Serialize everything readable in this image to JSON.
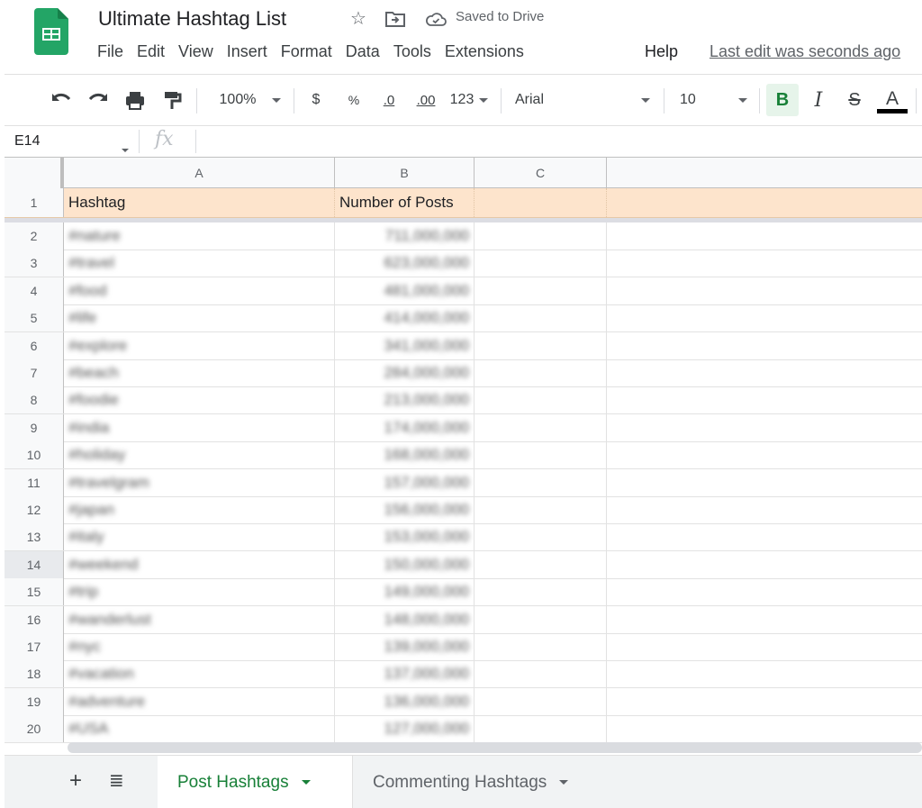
{
  "app": {
    "doc_title": "Ultimate Hashtag List",
    "saved_status": "Saved to Drive",
    "last_edit": "Last edit was seconds ago",
    "brand_color": "#188038",
    "header_fill": "#fde4cc"
  },
  "title_icons": [
    "star-icon",
    "move-to-folder-icon",
    "cloud-saved-icon"
  ],
  "menu": [
    "File",
    "Edit",
    "View",
    "Insert",
    "Format",
    "Data",
    "Tools",
    "Extensions"
  ],
  "menu_help": "Help",
  "toolbar": {
    "zoom": "100%",
    "currency": "$",
    "percent": "%",
    "decrease_decimal": ".0",
    "increase_decimal": ".00",
    "more_formats": "123",
    "font": "Arial",
    "font_size": "10",
    "bold": "B",
    "italic": "I",
    "strikethrough": "S",
    "text_color": "A"
  },
  "formula_bar": {
    "name_box": "E14",
    "fx": "fx",
    "content": ""
  },
  "columns": [
    "A",
    "B",
    "C"
  ],
  "header_row": {
    "row_number": "1",
    "cells": [
      "Hashtag",
      "Number of Posts",
      ""
    ]
  },
  "selected_row": "14",
  "rows": [
    {
      "n": "2",
      "tag": "#nature",
      "posts": "711,000,000"
    },
    {
      "n": "3",
      "tag": "#travel",
      "posts": "623,000,000"
    },
    {
      "n": "4",
      "tag": "#food",
      "posts": "481,000,000"
    },
    {
      "n": "5",
      "tag": "#life",
      "posts": "414,000,000"
    },
    {
      "n": "6",
      "tag": "#explore",
      "posts": "341,000,000"
    },
    {
      "n": "7",
      "tag": "#beach",
      "posts": "284,000,000"
    },
    {
      "n": "8",
      "tag": "#foodie",
      "posts": "213,000,000"
    },
    {
      "n": "9",
      "tag": "#india",
      "posts": "174,000,000"
    },
    {
      "n": "10",
      "tag": "#holiday",
      "posts": "168,000,000"
    },
    {
      "n": "11",
      "tag": "#travelgram",
      "posts": "157,000,000"
    },
    {
      "n": "12",
      "tag": "#japan",
      "posts": "156,000,000"
    },
    {
      "n": "13",
      "tag": "#italy",
      "posts": "153,000,000"
    },
    {
      "n": "14",
      "tag": "#weekend",
      "posts": "150,000,000"
    },
    {
      "n": "15",
      "tag": "#trip",
      "posts": "149,000,000"
    },
    {
      "n": "16",
      "tag": "#wanderlust",
      "posts": "148,000,000"
    },
    {
      "n": "17",
      "tag": "#nyc",
      "posts": "139,000,000"
    },
    {
      "n": "18",
      "tag": "#vacation",
      "posts": "137,000,000"
    },
    {
      "n": "19",
      "tag": "#adventure",
      "posts": "136,000,000"
    },
    {
      "n": "20",
      "tag": "#USA",
      "posts": "127,000,000"
    }
  ],
  "sheet_tabs": [
    {
      "label": "Post Hashtags",
      "active": true
    },
    {
      "label": "Commenting Hashtags",
      "active": false
    }
  ]
}
